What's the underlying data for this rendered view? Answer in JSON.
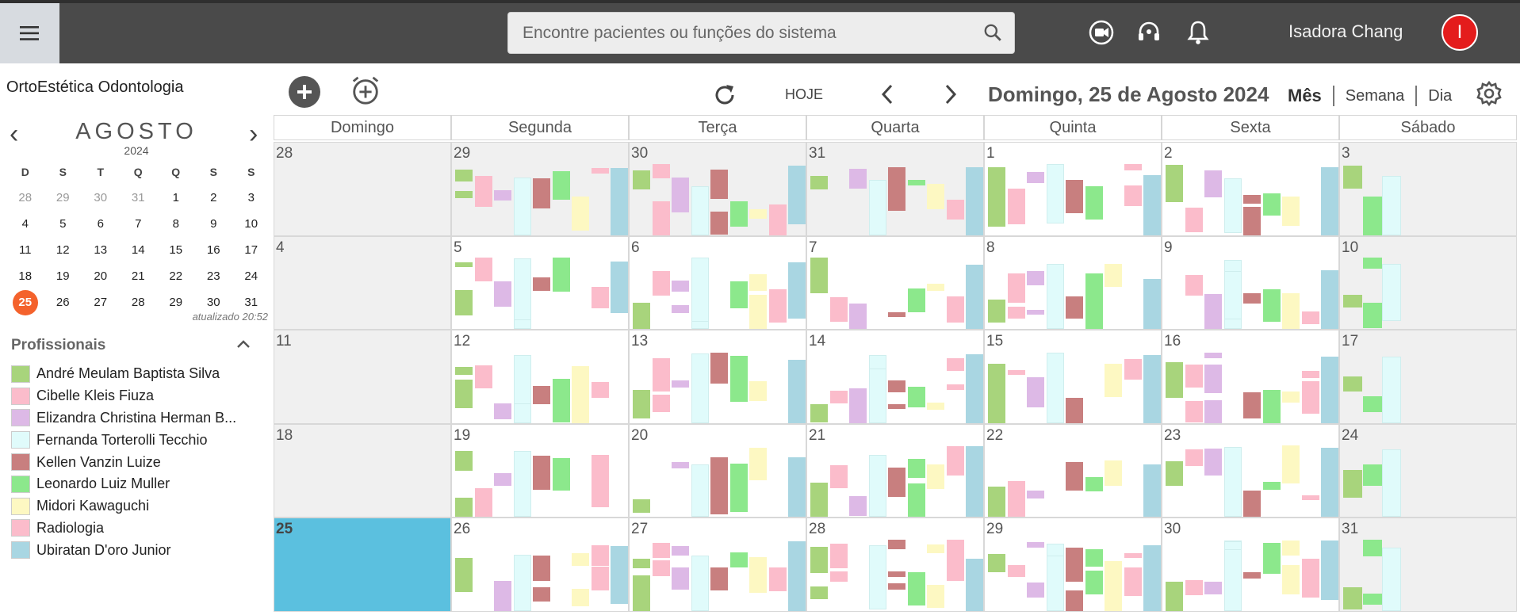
{
  "header": {
    "search_placeholder": "Encontre pacientes ou funções do sistema",
    "user_name": "Isadora Chang",
    "avatar_initial": "I"
  },
  "sidebar": {
    "clinic_name": "OrtoEstética Odontologia",
    "mini_calendar": {
      "month": "AGOSTO",
      "year": "2024",
      "weekday_headers": [
        "D",
        "S",
        "T",
        "Q",
        "Q",
        "S",
        "S"
      ],
      "weeks": [
        [
          "28",
          "29",
          "30",
          "31",
          "1",
          "2",
          "3"
        ],
        [
          "4",
          "5",
          "6",
          "7",
          "8",
          "9",
          "10"
        ],
        [
          "11",
          "12",
          "13",
          "14",
          "15",
          "16",
          "17"
        ],
        [
          "18",
          "19",
          "20",
          "21",
          "22",
          "23",
          "24"
        ],
        [
          "25",
          "26",
          "27",
          "28",
          "29",
          "30",
          "31"
        ]
      ],
      "selected_day": "25",
      "updated_text": "atualizado 20:52"
    },
    "professionals_title": "Profissionais",
    "professionals": [
      {
        "name": "André Meulam Baptista Silva",
        "color": "#a8d47c"
      },
      {
        "name": "Cibelle Kleis Fiuza",
        "color": "#fbbccb"
      },
      {
        "name": "Elizandra Christina Herman B...",
        "color": "#ddb9e6"
      },
      {
        "name": "Fernanda Torterolli Tecchio",
        "color": "#e0fbfb"
      },
      {
        "name": "Kellen Vanzin Luize",
        "color": "#c87f7f"
      },
      {
        "name": "Leonardo Luiz Muller",
        "color": "#8ce88c"
      },
      {
        "name": "Midori Kawaguchi",
        "color": "#fdf8c2"
      },
      {
        "name": "Radiologia",
        "color": "#fbbccb"
      },
      {
        "name": "Ubiratan D'oro Junior",
        "color": "#a9d6e2"
      }
    ]
  },
  "toolbar": {
    "today_label": "HOJE",
    "current_date": "Domingo, 25 de Agosto 2024",
    "views": [
      "Mês",
      "Semana",
      "Dia"
    ],
    "active_view": "Mês"
  },
  "calendar": {
    "weekdays": [
      "Domingo",
      "Segunda",
      "Terça",
      "Quarta",
      "Quinta",
      "Sexta",
      "Sábado"
    ],
    "weeks": [
      [
        "28",
        "29",
        "30",
        "31",
        "1",
        "2",
        "3"
      ],
      [
        "4",
        "5",
        "6",
        "7",
        "8",
        "9",
        "10"
      ],
      [
        "11",
        "12",
        "13",
        "14",
        "15",
        "16",
        "17"
      ],
      [
        "18",
        "19",
        "20",
        "21",
        "22",
        "23",
        "24"
      ],
      [
        "25",
        "26",
        "27",
        "28",
        "29",
        "30",
        "31"
      ]
    ],
    "today_cell": "25"
  }
}
